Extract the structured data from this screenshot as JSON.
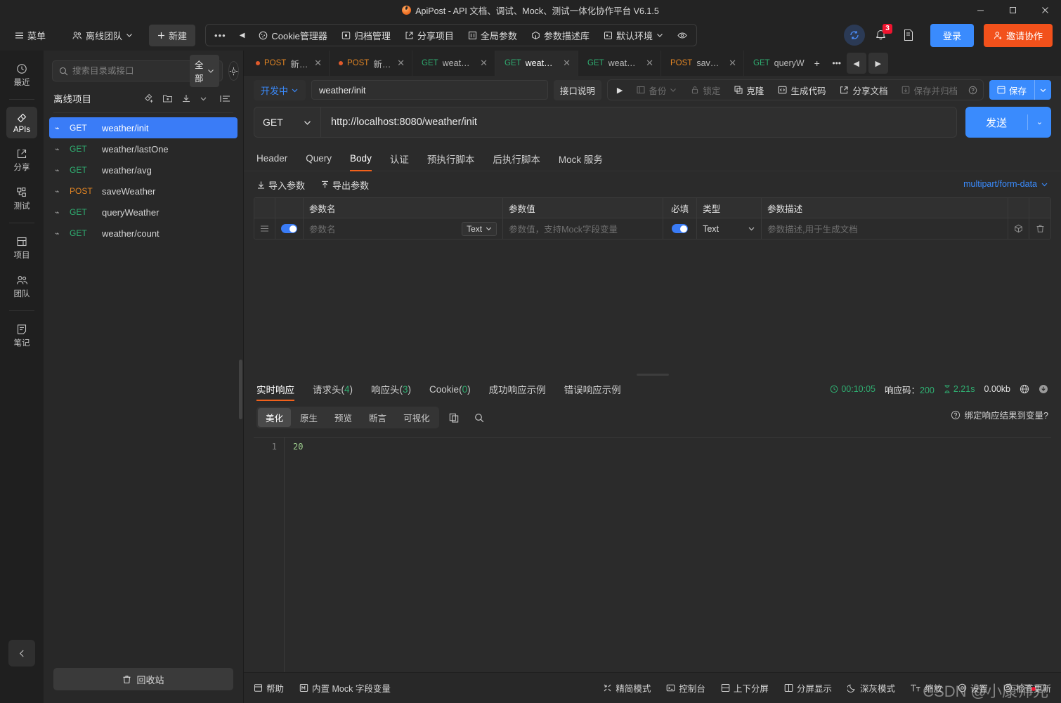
{
  "window": {
    "title": "ApiPost - API 文档、调试、Mock、测试一体化协作平台 V6.1.5",
    "minimize": "—",
    "maximize": "❐",
    "close": "✕"
  },
  "toolbar": {
    "menu": "菜单",
    "team": "离线团队",
    "new": "新建",
    "dots": "•••",
    "back": "◀",
    "items": [
      {
        "label": "Cookie管理器",
        "icon": "cookie-icon"
      },
      {
        "label": "归档管理",
        "icon": "archive-icon"
      },
      {
        "label": "分享项目",
        "icon": "share-icon"
      },
      {
        "label": "全局参数",
        "icon": "global-param-icon"
      },
      {
        "label": "参数描述库",
        "icon": "param-lib-icon"
      },
      {
        "label": "默认环境",
        "icon": "env-icon"
      }
    ],
    "eye": "👁",
    "notification_count": "3",
    "login": "登录",
    "invite": "邀请协作"
  },
  "rail": {
    "items": [
      {
        "label": "最近",
        "icon": "clock-icon",
        "active": false
      },
      {
        "label": "APIs",
        "icon": "api-icon",
        "active": true
      },
      {
        "label": "分享",
        "icon": "share-icon",
        "active": false
      },
      {
        "label": "测试",
        "icon": "test-icon",
        "active": false
      },
      {
        "label": "项目",
        "icon": "project-icon",
        "active": false
      },
      {
        "label": "团队",
        "icon": "team-icon",
        "active": false
      },
      {
        "label": "笔记",
        "icon": "note-icon",
        "active": false
      }
    ],
    "collapse": "‹"
  },
  "sidebar": {
    "search_placeholder": "搜索目录或接口",
    "search_value": "",
    "filter": "全部",
    "project_name": "离线项目",
    "apis": [
      {
        "method": "GET",
        "name": "weather/init",
        "active": true
      },
      {
        "method": "GET",
        "name": "weather/lastOne",
        "active": false
      },
      {
        "method": "GET",
        "name": "weather/avg",
        "active": false
      },
      {
        "method": "POST",
        "name": "saveWeather",
        "active": false
      },
      {
        "method": "GET",
        "name": "queryWeather",
        "active": false
      },
      {
        "method": "GET",
        "name": "weather/count",
        "active": false
      }
    ],
    "recycle": "回收站"
  },
  "tabs": {
    "items": [
      {
        "method": "POST",
        "label": "新建接口",
        "unsaved": true,
        "active": false
      },
      {
        "method": "POST",
        "label": "新建接口",
        "unsaved": true,
        "active": false
      },
      {
        "method": "GET",
        "label": "weather/...",
        "unsaved": false,
        "active": false
      },
      {
        "method": "GET",
        "label": "weather/...",
        "unsaved": false,
        "active": true
      },
      {
        "method": "GET",
        "label": "weather/...",
        "unsaved": false,
        "active": false
      },
      {
        "method": "POST",
        "label": "saveWe...",
        "unsaved": false,
        "active": false
      },
      {
        "method": "GET",
        "label": "queryW",
        "unsaved": false,
        "active": false
      }
    ],
    "close": "✕",
    "add": "+",
    "more": "•••",
    "prev": "◀",
    "next": "▶"
  },
  "api_header": {
    "status": "开发中",
    "name": "weather/init",
    "desc_button": "接口说明",
    "run": "▶",
    "backup": "备份",
    "lock": "锁定",
    "clone": "克隆",
    "gencode": "生成代码",
    "sharedoc": "分享文档",
    "save_archive": "保存并归档",
    "help": "?",
    "save": "保存"
  },
  "url_bar": {
    "method": "GET",
    "url": "http://localhost:8080/weather/init",
    "send": "发送"
  },
  "request": {
    "tabs": [
      {
        "label": "Header",
        "active": false
      },
      {
        "label": "Query",
        "active": false
      },
      {
        "label": "Body",
        "active": true
      },
      {
        "label": "认证",
        "active": false
      },
      {
        "label": "预执行脚本",
        "active": false
      },
      {
        "label": "后执行脚本",
        "active": false
      },
      {
        "label": "Mock 服务",
        "active": false
      }
    ],
    "import": "导入参数",
    "export": "导出参数",
    "content_type": "multipart/form-data",
    "table": {
      "headers": [
        "",
        "",
        "参数名",
        "参数值",
        "必填",
        "类型",
        "参数描述",
        "",
        ""
      ],
      "row": {
        "name_placeholder": "参数名",
        "name_type": "Text",
        "value_placeholder": "参数值，支持Mock字段变量",
        "required": true,
        "type": "Text",
        "desc_placeholder": "参数描述,用于生成文档"
      }
    }
  },
  "response": {
    "tabs": [
      {
        "label": "实时响应",
        "count": "",
        "active": true
      },
      {
        "label": "请求头",
        "count": "4",
        "active": false
      },
      {
        "label": "响应头",
        "count": "3",
        "active": false
      },
      {
        "label": "Cookie",
        "count": "0",
        "active": false
      },
      {
        "label": "成功响应示例",
        "count": "",
        "active": false
      },
      {
        "label": "错误响应示例",
        "count": "",
        "active": false
      }
    ],
    "meta": {
      "time": "00:10:05",
      "code_label": "响应码：",
      "code": "200",
      "duration": "2.21s",
      "size": "0.00kb"
    },
    "view_modes": [
      {
        "label": "美化",
        "active": true
      },
      {
        "label": "原生",
        "active": false
      },
      {
        "label": "预览",
        "active": false
      },
      {
        "label": "断言",
        "active": false
      },
      {
        "label": "可视化",
        "active": false
      }
    ],
    "bind_var": "绑定响应结果到变量?",
    "body_lines": [
      "20"
    ],
    "line_numbers": [
      "1"
    ]
  },
  "status_bar": {
    "left": [
      {
        "label": "帮助",
        "icon": "help-icon"
      },
      {
        "label": "内置 Mock 字段变量",
        "icon": "mock-icon"
      }
    ],
    "right": [
      {
        "label": "精简模式",
        "icon": "compact-icon"
      },
      {
        "label": "控制台",
        "icon": "console-icon"
      },
      {
        "label": "上下分屏",
        "icon": "split-vertical-icon"
      },
      {
        "label": "分屏显示",
        "icon": "split-icon"
      },
      {
        "label": "深灰模式",
        "icon": "moon-icon"
      },
      {
        "label": "缩放",
        "icon": "zoom-icon"
      },
      {
        "label": "设置",
        "icon": "gear-icon"
      },
      {
        "label": "检查更新",
        "icon": "update-icon"
      }
    ],
    "watermark": "CSDN @小康师兄"
  },
  "colors": {
    "accent_blue": "#3a8bfd",
    "accent_orange": "#f2511b",
    "get_green": "#2fae71",
    "post_orange": "#e08424",
    "tab_underline": "#f2611b"
  }
}
